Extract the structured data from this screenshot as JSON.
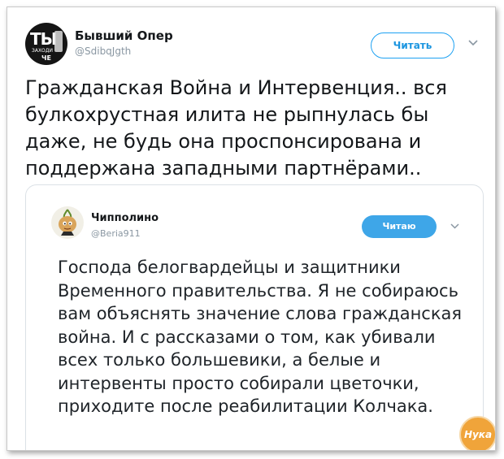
{
  "tweet": {
    "author_name": "Бывший Опер",
    "author_handle": "@SdibqJgth",
    "avatar_text_big": "ТЫ",
    "avatar_text_small": "ЗАХОДИ",
    "avatar_text_bottom": "ЧЕ",
    "follow_label": "Читать",
    "text": "Гражданская Война и Интервенция.. вся булкохрустная илита не рыпнулась бы даже, не будь она проспонсирована и поддержана западными партнёрами.."
  },
  "quoted_tweet": {
    "author_name": "Чипполино",
    "author_handle": "@Beria911",
    "following_label": "Читаю",
    "text": "Господа белогвардейцы и защитники Временного правительства. Я не собираюсь вам объяснять значение слова гражданская война.  И с рассказами о том, как убивали всех только большевики, а белые и интервенты просто собирали цветочки, приходите после реабилитации Колчака."
  },
  "watermark": {
    "text": "Нука"
  },
  "colors": {
    "accent": "#1da1f2",
    "text": "#14171a",
    "muted": "#8a97a2",
    "watermark": "#f0a43a"
  },
  "icons": {
    "menu_chevron": "chevron-down-icon"
  }
}
